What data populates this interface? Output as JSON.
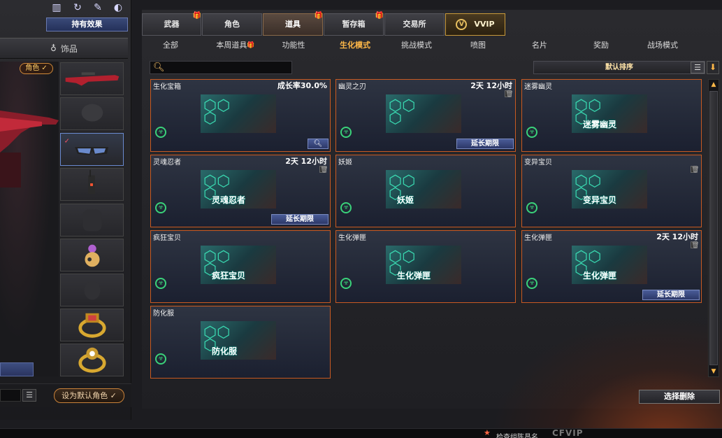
{
  "left": {
    "owned_effects": "持有效果",
    "accessory_tab": "饰品",
    "character_badge": "角色 ✓",
    "default_role_button": "设为默认角色 ✓"
  },
  "tabs": [
    {
      "label": "武器",
      "gift": true
    },
    {
      "label": "角色",
      "gift": false
    },
    {
      "label": "道具",
      "gift": true,
      "active": true
    },
    {
      "label": "暂存箱",
      "gift": true
    },
    {
      "label": "交易所",
      "gift": false
    },
    {
      "label": "VVIP",
      "gift": false
    }
  ],
  "subtabs": [
    {
      "label": "全部"
    },
    {
      "label": "本周道具",
      "gift": true
    },
    {
      "label": "功能性"
    },
    {
      "label": "生化模式",
      "active": true
    },
    {
      "label": "挑战模式"
    },
    {
      "label": "喷图"
    },
    {
      "label": "名片"
    },
    {
      "label": "奖励"
    },
    {
      "label": "战场模式"
    }
  ],
  "search": {
    "placeholder": ""
  },
  "sort": {
    "label": "默认排序"
  },
  "items": [
    {
      "name": "生化宝箱",
      "right": "成长率30.0%",
      "caption": "",
      "button": "search",
      "lock": false
    },
    {
      "name": "幽灵之刃",
      "right": "2天 12小时",
      "caption": "",
      "button": "延长期限",
      "lock": true
    },
    {
      "name": "迷雾幽灵",
      "right": "",
      "caption": "迷雾幽灵",
      "button": "",
      "lock": false
    },
    {
      "name": "灵魂忍者",
      "right": "2天 12小时",
      "caption": "灵魂忍者",
      "button": "延长期限",
      "lock": true
    },
    {
      "name": "妖姬",
      "right": "",
      "caption": "妖姬",
      "button": "",
      "lock": false
    },
    {
      "name": "变异宝贝",
      "right": "",
      "caption": "变异宝贝",
      "button": "",
      "lock": true
    },
    {
      "name": "疯狂宝贝",
      "right": "",
      "caption": "疯狂宝贝",
      "button": "",
      "lock": false
    },
    {
      "name": "生化弹匣",
      "right": "",
      "caption": "生化弹匣",
      "button": "",
      "lock": false
    },
    {
      "name": "生化弹匣",
      "right": "2天 12小时",
      "caption": "生化弹匣",
      "button": "延长期限",
      "lock": true
    },
    {
      "name": "防化服",
      "right": "",
      "caption": "防化服",
      "button": "",
      "lock": false
    }
  ],
  "delete_button": "选择删除",
  "taskbar": {
    "text": "检查组陈昌名",
    "logo": "CFVIP"
  }
}
